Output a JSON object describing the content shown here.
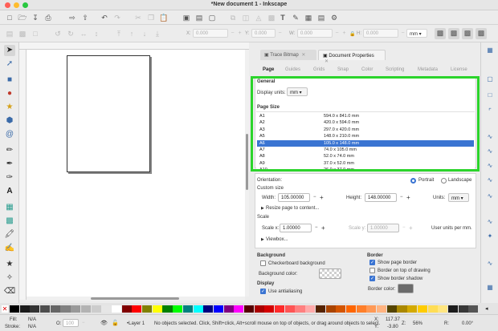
{
  "window": {
    "title": "*New document 1 - Inkscape"
  },
  "traffic_colors": {
    "close": "#ff5f57",
    "minimize": "#febc2e",
    "maximize": "#28c840"
  },
  "toolbar2": {
    "x_label": "X:",
    "x_value": "0.000",
    "y_label": "Y:",
    "y_value": "0.000",
    "w_label": "W:",
    "w_value": "0.000",
    "h_label": "H:",
    "h_value": "0.000",
    "unit": "mm"
  },
  "dialog": {
    "tabs": [
      {
        "label": "Trace Bitmap"
      },
      {
        "label": "Document Properties"
      }
    ],
    "subtabs": [
      "Page",
      "Guides",
      "Grids",
      "Snap",
      "Color",
      "Scripting",
      "Metadata",
      "License"
    ],
    "general": {
      "heading": "General",
      "display_units_label": "Display units:",
      "display_units_value": "mm"
    },
    "page_size": {
      "heading": "Page Size",
      "rows": [
        {
          "name": "A1",
          "size": "594.0 x 841.0 mm"
        },
        {
          "name": "A2",
          "size": "420.0 x 594.0 mm"
        },
        {
          "name": "A3",
          "size": "297.0 x 420.0 mm"
        },
        {
          "name": "A5",
          "size": "148.0 x 210.0 mm"
        },
        {
          "name": "A6",
          "size": "105.0 x 148.0 mm",
          "selected": true
        },
        {
          "name": "A7",
          "size": "74.0 x 105.0 mm"
        },
        {
          "name": "A8",
          "size": "52.0 x 74.0 mm"
        },
        {
          "name": "A9",
          "size": "37.0 x 52.0 mm"
        },
        {
          "name": "A10",
          "size": "26.0 x 37.0 mm"
        }
      ]
    },
    "orientation": {
      "label": "Orientation:",
      "portrait": "Portrait",
      "landscape": "Landscape"
    },
    "custom_size": {
      "heading": "Custom size",
      "width_label": "Width:",
      "width_value": "105.00000",
      "height_label": "Height:",
      "height_value": "148.00000",
      "units_label": "Units:",
      "units_value": "mm",
      "resize_label": "Resize page to content..."
    },
    "scale": {
      "heading": "Scale",
      "scale_x_label": "Scale x:",
      "scale_x_value": "1.00000",
      "scale_y_label": "Scale y:",
      "scale_y_value": "1.00000",
      "user_units": "User units per mm.",
      "viewbox_label": "Viewbox..."
    },
    "background": {
      "heading": "Background",
      "checkerboard": "Checkerboard background",
      "color_label": "Background color:"
    },
    "border": {
      "heading": "Border",
      "show_border": "Show page border",
      "on_top": "Border on top of drawing",
      "shadow": "Show border shadow",
      "color_label": "Border color:"
    },
    "display": {
      "heading": "Display",
      "antialiasing": "Use antialiasing"
    }
  },
  "status": {
    "fill_label": "Fill:",
    "fill_value": "N/A",
    "stroke_label": "Stroke:",
    "stroke_value": "N/A",
    "opacity_label": "O:",
    "opacity_value": "100",
    "layer": "•Layer 1",
    "message": "No objects selected. Click, Shift+click, Alt+scroll mouse on top of objects, or drag around objects to select.",
    "x_label": "X:",
    "x_value": "117.37",
    "y_label": "Y:",
    "y_value": "-3.80",
    "zoom_label": "Z:",
    "zoom_value": "56%",
    "rotate_label": "R:",
    "rotate_value": "0.00°"
  },
  "palette_colors": [
    "#000000",
    "#1a1a1a",
    "#333333",
    "#4d4d4d",
    "#666666",
    "#808080",
    "#999999",
    "#b3b3b3",
    "#cccccc",
    "#e6e6e6",
    "#ffffff",
    "#800000",
    "#ff0000",
    "#808000",
    "#ffff00",
    "#008000",
    "#00ff00",
    "#008080",
    "#00ffff",
    "#000080",
    "#0000ff",
    "#800080",
    "#ff00ff",
    "#550000",
    "#aa0000",
    "#d40000",
    "#ff2a2a",
    "#ff5555",
    "#ff8080",
    "#ffaaaa",
    "#552200",
    "#aa4400",
    "#d45500",
    "#ff6600",
    "#ff7f2a",
    "#ff9955",
    "#ffb380",
    "#554400",
    "#aa8800",
    "#d4aa00",
    "#ffcc00",
    "#ffdd55",
    "#ffe680",
    "#1c1c1c",
    "#383838",
    "#555555"
  ],
  "accent": "#3a74d2",
  "highlight": "#2bd42b"
}
